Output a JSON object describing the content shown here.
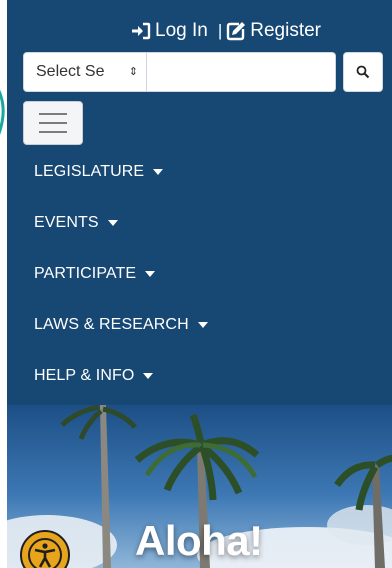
{
  "header": {
    "login_label": "Log In",
    "separator": "|",
    "register_label": "Register"
  },
  "search": {
    "select_value": "Select Se",
    "input_value": "",
    "input_placeholder": ""
  },
  "nav": {
    "items": [
      {
        "label": "LEGISLATURE"
      },
      {
        "label": "EVENTS"
      },
      {
        "label": "PARTICIPATE"
      },
      {
        "label": "LAWS & RESEARCH"
      },
      {
        "label": "HELP & INFO"
      }
    ]
  },
  "hero": {
    "title": "Aloha!"
  },
  "colors": {
    "nav_background": "#174873",
    "accessibility_button": "#e8a51c"
  },
  "icons": [
    "sign-in-icon",
    "edit-icon",
    "search-icon",
    "hamburger-icon",
    "accessibility-icon"
  ]
}
